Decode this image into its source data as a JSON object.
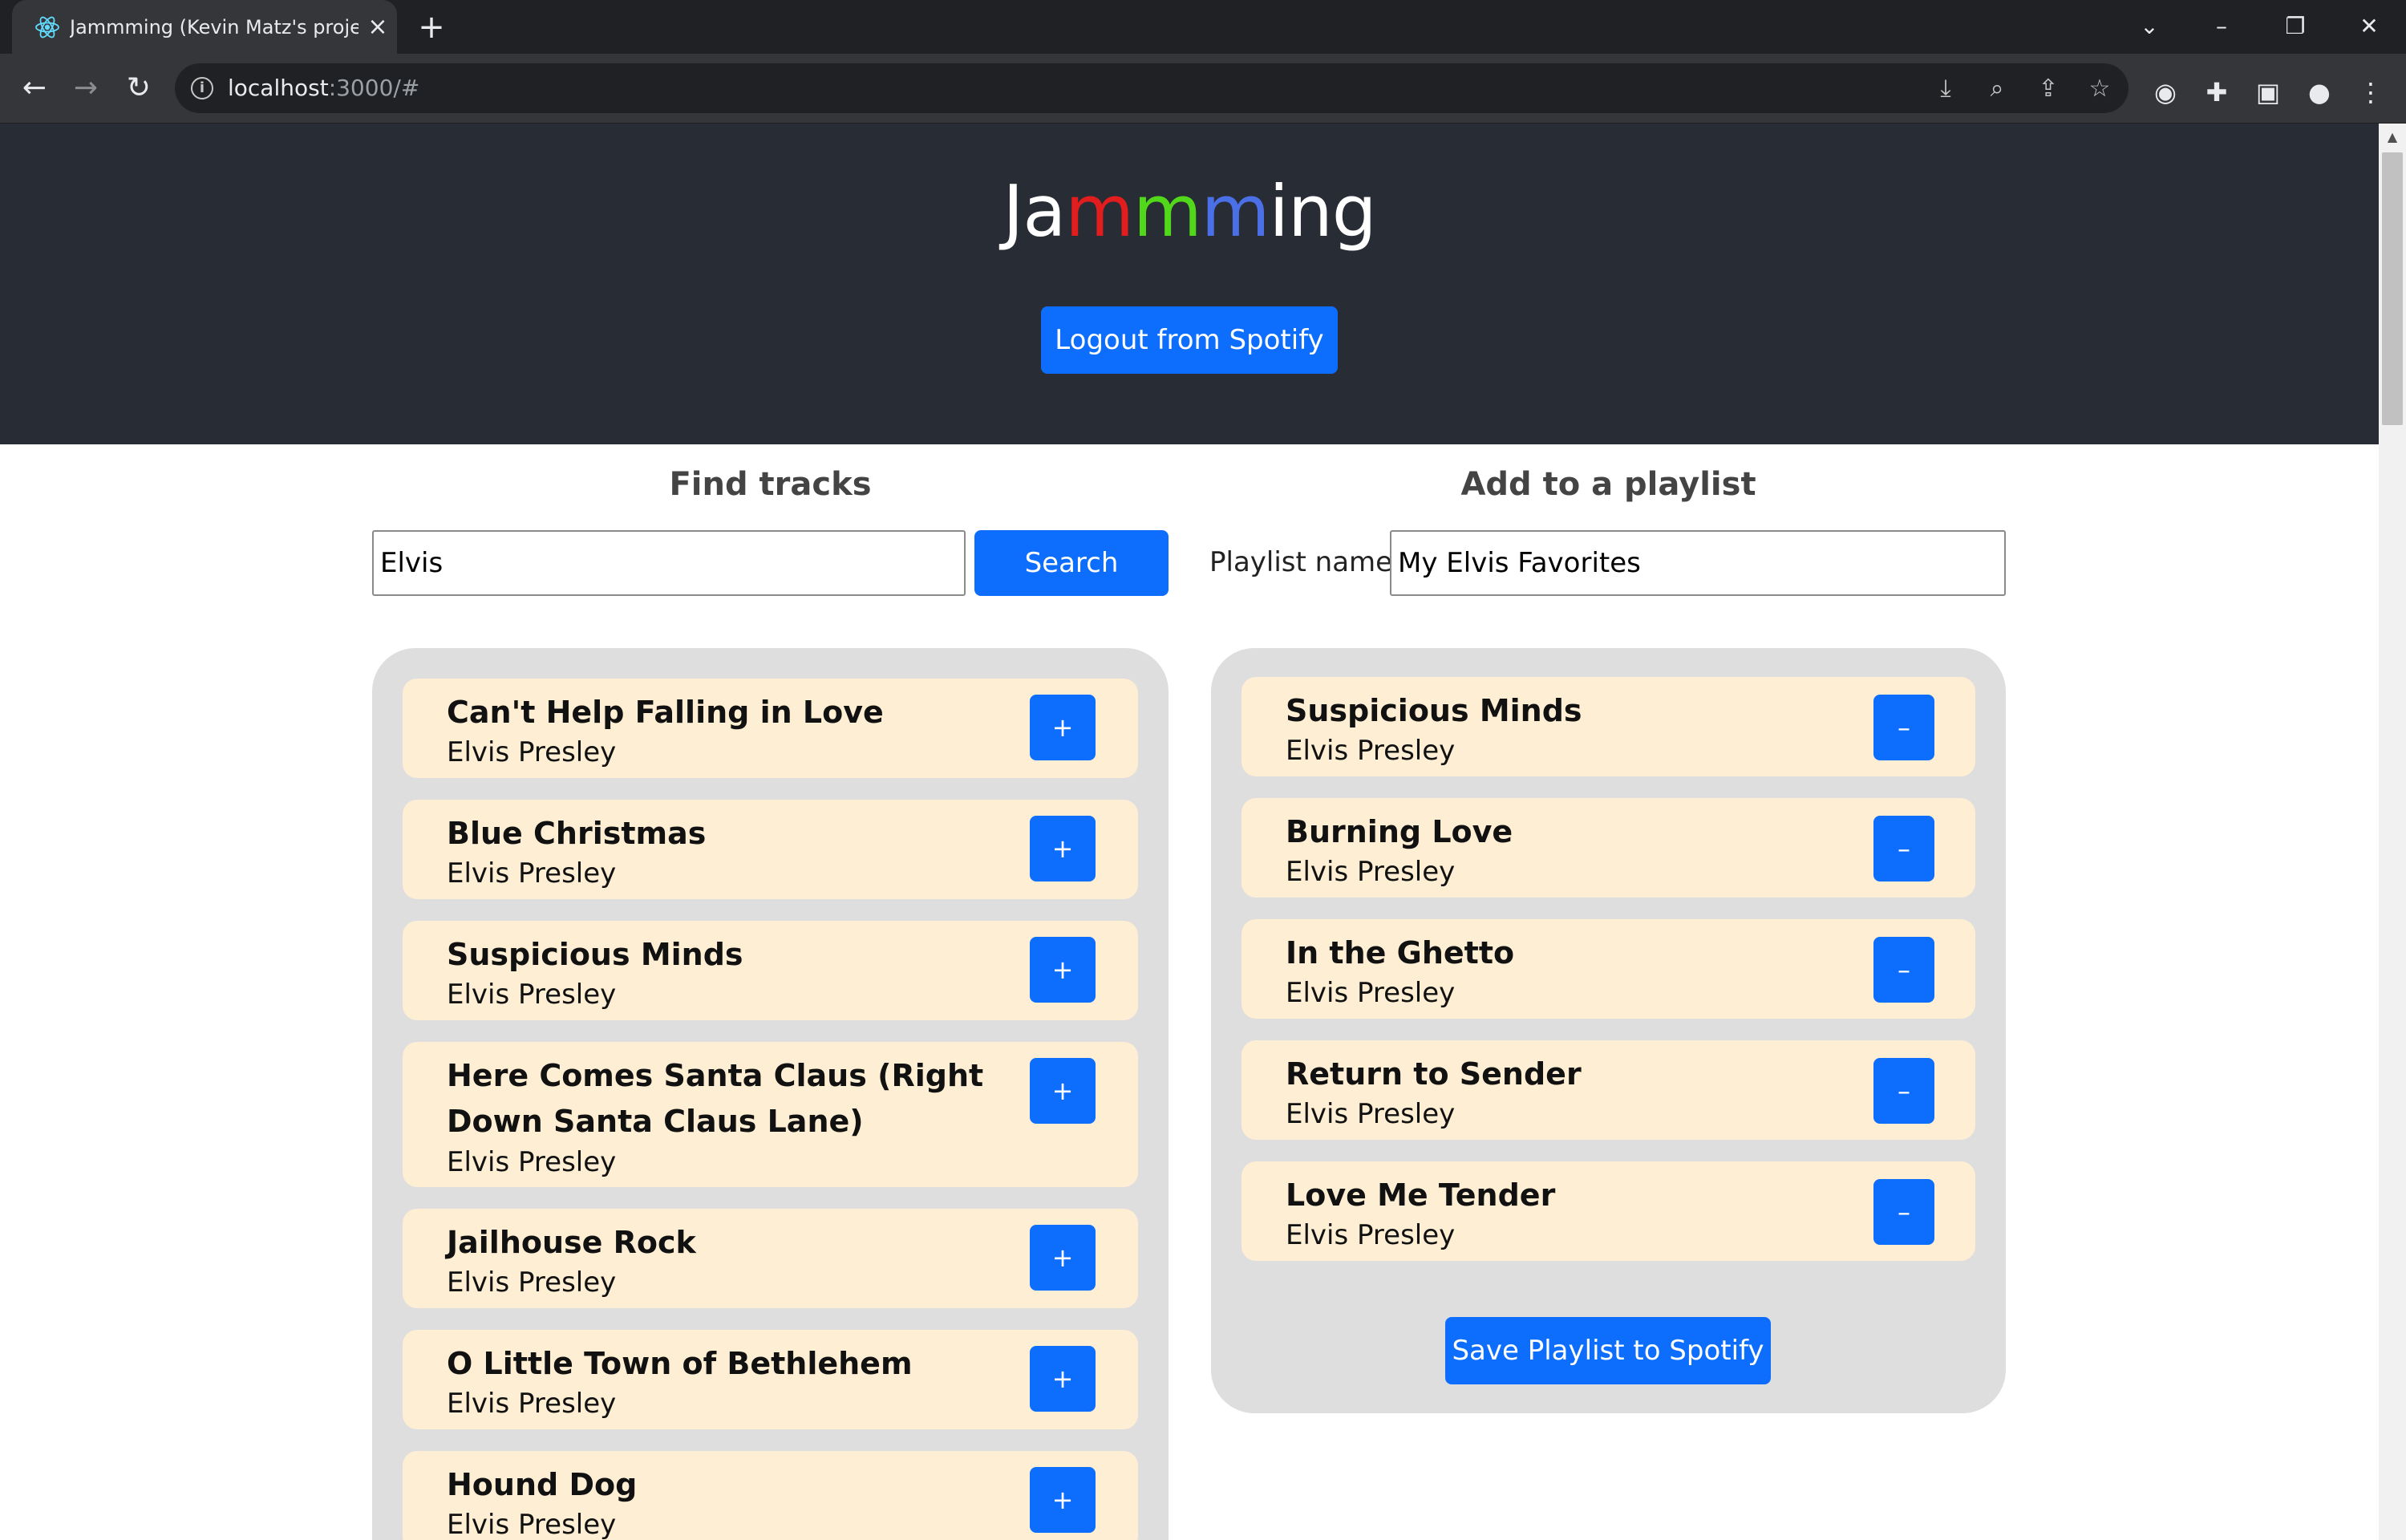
{
  "browser": {
    "tab_title": "Jammming (Kevin Matz's project)",
    "url_host": "localhost",
    "url_path": ":3000/#",
    "icons": {
      "favicon": "react-icon",
      "tab_close": "close-icon",
      "new_tab": "plus-icon",
      "tab_search": "chevron-down-icon",
      "minimize": "minimize-icon",
      "restore": "restore-icon",
      "close_window": "close-icon",
      "back": "arrow-left-icon",
      "forward": "arrow-right-icon",
      "reload": "reload-icon",
      "site_info": "info-icon",
      "install": "install-icon",
      "zoom": "zoom-icon",
      "share": "share-icon",
      "bookmark": "star-icon",
      "extension_avatar": "extension-icon",
      "extensions": "puzzle-icon",
      "side_panel": "side-panel-icon",
      "profile": "profile-icon",
      "menu": "kebab-menu-icon"
    }
  },
  "app": {
    "title_parts": [
      "Ja",
      "m",
      "m",
      "m",
      "ing"
    ],
    "title_colors": [
      "#ffffff",
      "#e11d1d",
      "#52d81a",
      "#4b6fe6",
      "#ffffff"
    ],
    "logout_label": "Logout from Spotify",
    "accent_color": "#0d6efd",
    "header_bg": "#282c34",
    "track_bg": "#feeed3"
  },
  "search": {
    "heading": "Find tracks",
    "query": "Elvis",
    "button_label": "Search",
    "add_symbol": "+",
    "results": [
      {
        "title": "Can't Help Falling in Love",
        "artist": "Elvis Presley"
      },
      {
        "title": "Blue Christmas",
        "artist": "Elvis Presley"
      },
      {
        "title": "Suspicious Minds",
        "artist": "Elvis Presley"
      },
      {
        "title": "Here Comes Santa Claus (Right Down Santa Claus Lane)",
        "artist": "Elvis Presley"
      },
      {
        "title": "Jailhouse Rock",
        "artist": "Elvis Presley"
      },
      {
        "title": "O Little Town of Bethlehem",
        "artist": "Elvis Presley"
      },
      {
        "title": "Hound Dog",
        "artist": "Elvis Presley"
      }
    ]
  },
  "playlist": {
    "heading": "Add to a playlist",
    "name_label": "Playlist name",
    "name_value": "My Elvis Favorites",
    "remove_symbol": "–",
    "tracks": [
      {
        "title": "Suspicious Minds",
        "artist": "Elvis Presley"
      },
      {
        "title": "Burning Love",
        "artist": "Elvis Presley"
      },
      {
        "title": "In the Ghetto",
        "artist": "Elvis Presley"
      },
      {
        "title": "Return to Sender",
        "artist": "Elvis Presley"
      },
      {
        "title": "Love Me Tender",
        "artist": "Elvis Presley"
      }
    ],
    "save_label": "Save Playlist to Spotify"
  }
}
